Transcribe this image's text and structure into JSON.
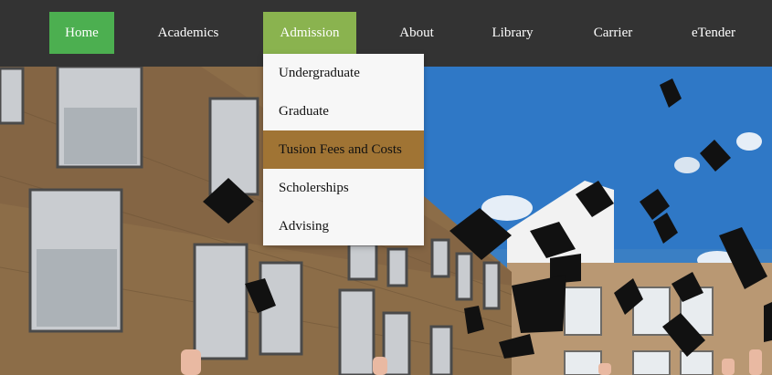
{
  "nav": {
    "items": [
      {
        "label": "Home"
      },
      {
        "label": "Academics"
      },
      {
        "label": "Admission"
      },
      {
        "label": "About"
      },
      {
        "label": "Library"
      },
      {
        "label": "Carrier"
      },
      {
        "label": "eTender"
      }
    ]
  },
  "admission_menu": {
    "items": [
      {
        "label": "Undergraduate"
      },
      {
        "label": "Graduate"
      },
      {
        "label": "Tusion Fees and Costs"
      },
      {
        "label": "Scholerships"
      },
      {
        "label": "Advising"
      }
    ]
  },
  "colors": {
    "navbar": "#333333",
    "home_bg": "#4caf50",
    "active_bg": "#8ab34f",
    "dropdown_hover": "#a07434"
  }
}
